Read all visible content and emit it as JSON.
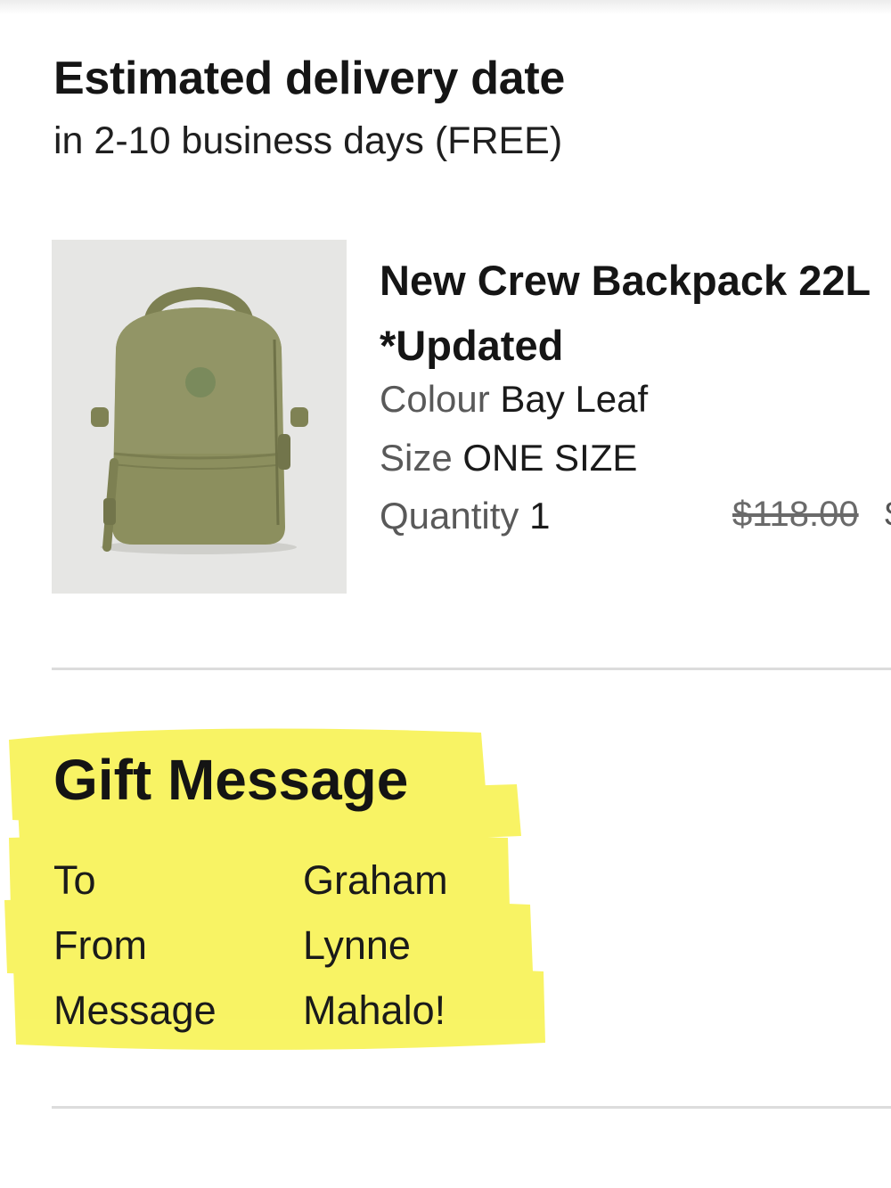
{
  "delivery": {
    "title": "Estimated delivery date",
    "subtitle": "in 2-10 business days (FREE)"
  },
  "product": {
    "name": "New Crew Backpack 22L *Updated",
    "image_icon": "backpack-image",
    "colour_label": "Colour",
    "colour_value": "Bay Leaf",
    "size_label": "Size",
    "size_value": "ONE SIZE",
    "quantity_label": "Quantity",
    "quantity_value": "1",
    "price_original": "$118.00",
    "price_sale": "$"
  },
  "gift": {
    "title": "Gift Message",
    "highlight_color": "#f7f24a",
    "rows": [
      {
        "label": "To",
        "value": "Graham"
      },
      {
        "label": "From",
        "value": "Lynne"
      },
      {
        "label": "Message",
        "value": "Mahalo!"
      }
    ]
  },
  "colors": {
    "backpack": "#8c8f5e",
    "image_bg": "#e6e6e4",
    "divider": "#dcdcdc"
  }
}
